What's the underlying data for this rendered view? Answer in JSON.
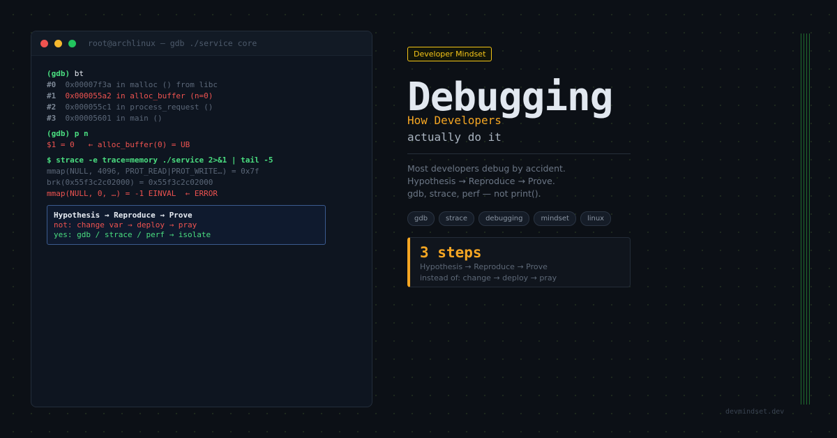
{
  "terminal": {
    "title": "root@archlinux  —  gdb ./service core",
    "bt": {
      "prompt": "(gdb)",
      "command": "bt",
      "frames": [
        {
          "num": "#0",
          "text": "0x00007f3a in malloc () from libc",
          "highlight": false
        },
        {
          "num": "#1",
          "text": "0x000055a2 in alloc_buffer (n=0)",
          "highlight": true
        },
        {
          "num": "#2",
          "text": "0x000055c1 in process_request ()",
          "highlight": false
        },
        {
          "num": "#3",
          "text": "0x00005601 in main ()",
          "highlight": false
        }
      ]
    },
    "print": {
      "prompt": "(gdb)",
      "command": "p n",
      "result": "$1 = 0   ← alloc_buffer(0) = UB"
    },
    "strace": {
      "command": "$ strace -e trace=memory ./service 2>&1 | tail -5",
      "lines": [
        {
          "text": "mmap(NULL, 4096, PROT_READ|PROT_WRITE…) = 0x7f",
          "error": false
        },
        {
          "text": "brk(0x55f3c2c02000) = 0x55f3c2c02000",
          "error": false
        },
        {
          "text": "mmap(NULL, 0, …) = -1 EINVAL  ← ERROR",
          "error": true
        }
      ]
    },
    "callout": {
      "title": "Hypothesis → Reproduce → Prove",
      "not_line": "not: change var → deploy → pray",
      "yes_line": "yes: gdb / strace / perf → isolate"
    }
  },
  "hero": {
    "badge": "Developer Mindset",
    "title": "Debugging",
    "subtitle_1": "How Developers",
    "subtitle_2": "actually do it",
    "description": [
      "Most developers debug by accident.",
      "Hypothesis → Reproduce → Prove.",
      "gdb, strace, perf — not print()."
    ],
    "tags": [
      "gdb",
      "strace",
      "debugging",
      "mindset",
      "linux"
    ],
    "steps_card": {
      "headline": "3 steps",
      "line_1": "Hypothesis → Reproduce → Prove",
      "line_2": "instead of: change → deploy → pray"
    }
  },
  "footer": {
    "site": "devmindset.dev"
  },
  "colors": {
    "background": "#0c1016",
    "accent_orange": "#f5a623",
    "accent_yellow": "#f5c518",
    "prompt_green": "#4ade80",
    "error_red": "#ef5350"
  }
}
